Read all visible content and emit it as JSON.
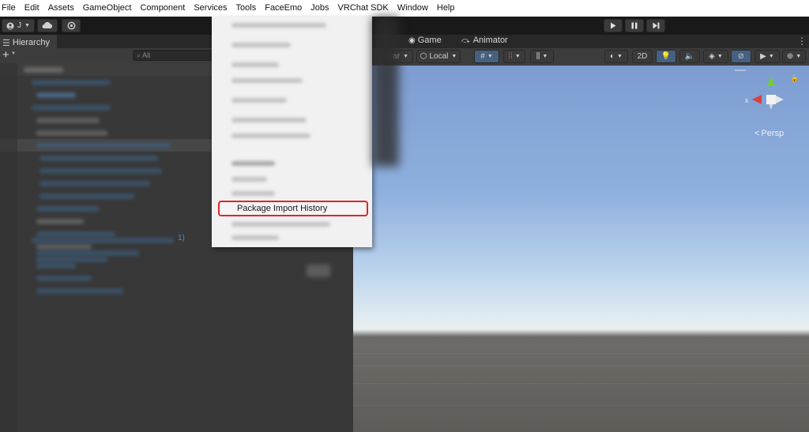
{
  "menubar": {
    "items": [
      "File",
      "Edit",
      "Assets",
      "GameObject",
      "Component",
      "Services",
      "Tools",
      "FaceEmo",
      "Jobs",
      "VRChat SDK",
      "Window",
      "Help"
    ]
  },
  "toolbar": {
    "account_label": "J",
    "play_icon": "play-icon",
    "pause_icon": "pause-icon",
    "step_icon": "step-icon"
  },
  "hierarchy": {
    "tab_label": "Hierarchy",
    "add_label": "+",
    "search_placeholder": "All",
    "stray_text": "1)"
  },
  "scene": {
    "tabs": [
      {
        "label": "Game",
        "icon": "gamepad-icon"
      },
      {
        "label": "Animator",
        "icon": "animator-icon"
      }
    ],
    "left_frag": "ar",
    "pivot_label": "Local",
    "mode_2d": "2D",
    "gizmo_label": "Persp",
    "gizmo_x": "x"
  },
  "tools_menu": {
    "highlighted_item": "Package Import History"
  },
  "colors": {
    "accent_highlight": "#d9262e",
    "sky_top": "#7d9cd0",
    "horizon": "#e9eef0",
    "ground": "#6e6a67"
  }
}
